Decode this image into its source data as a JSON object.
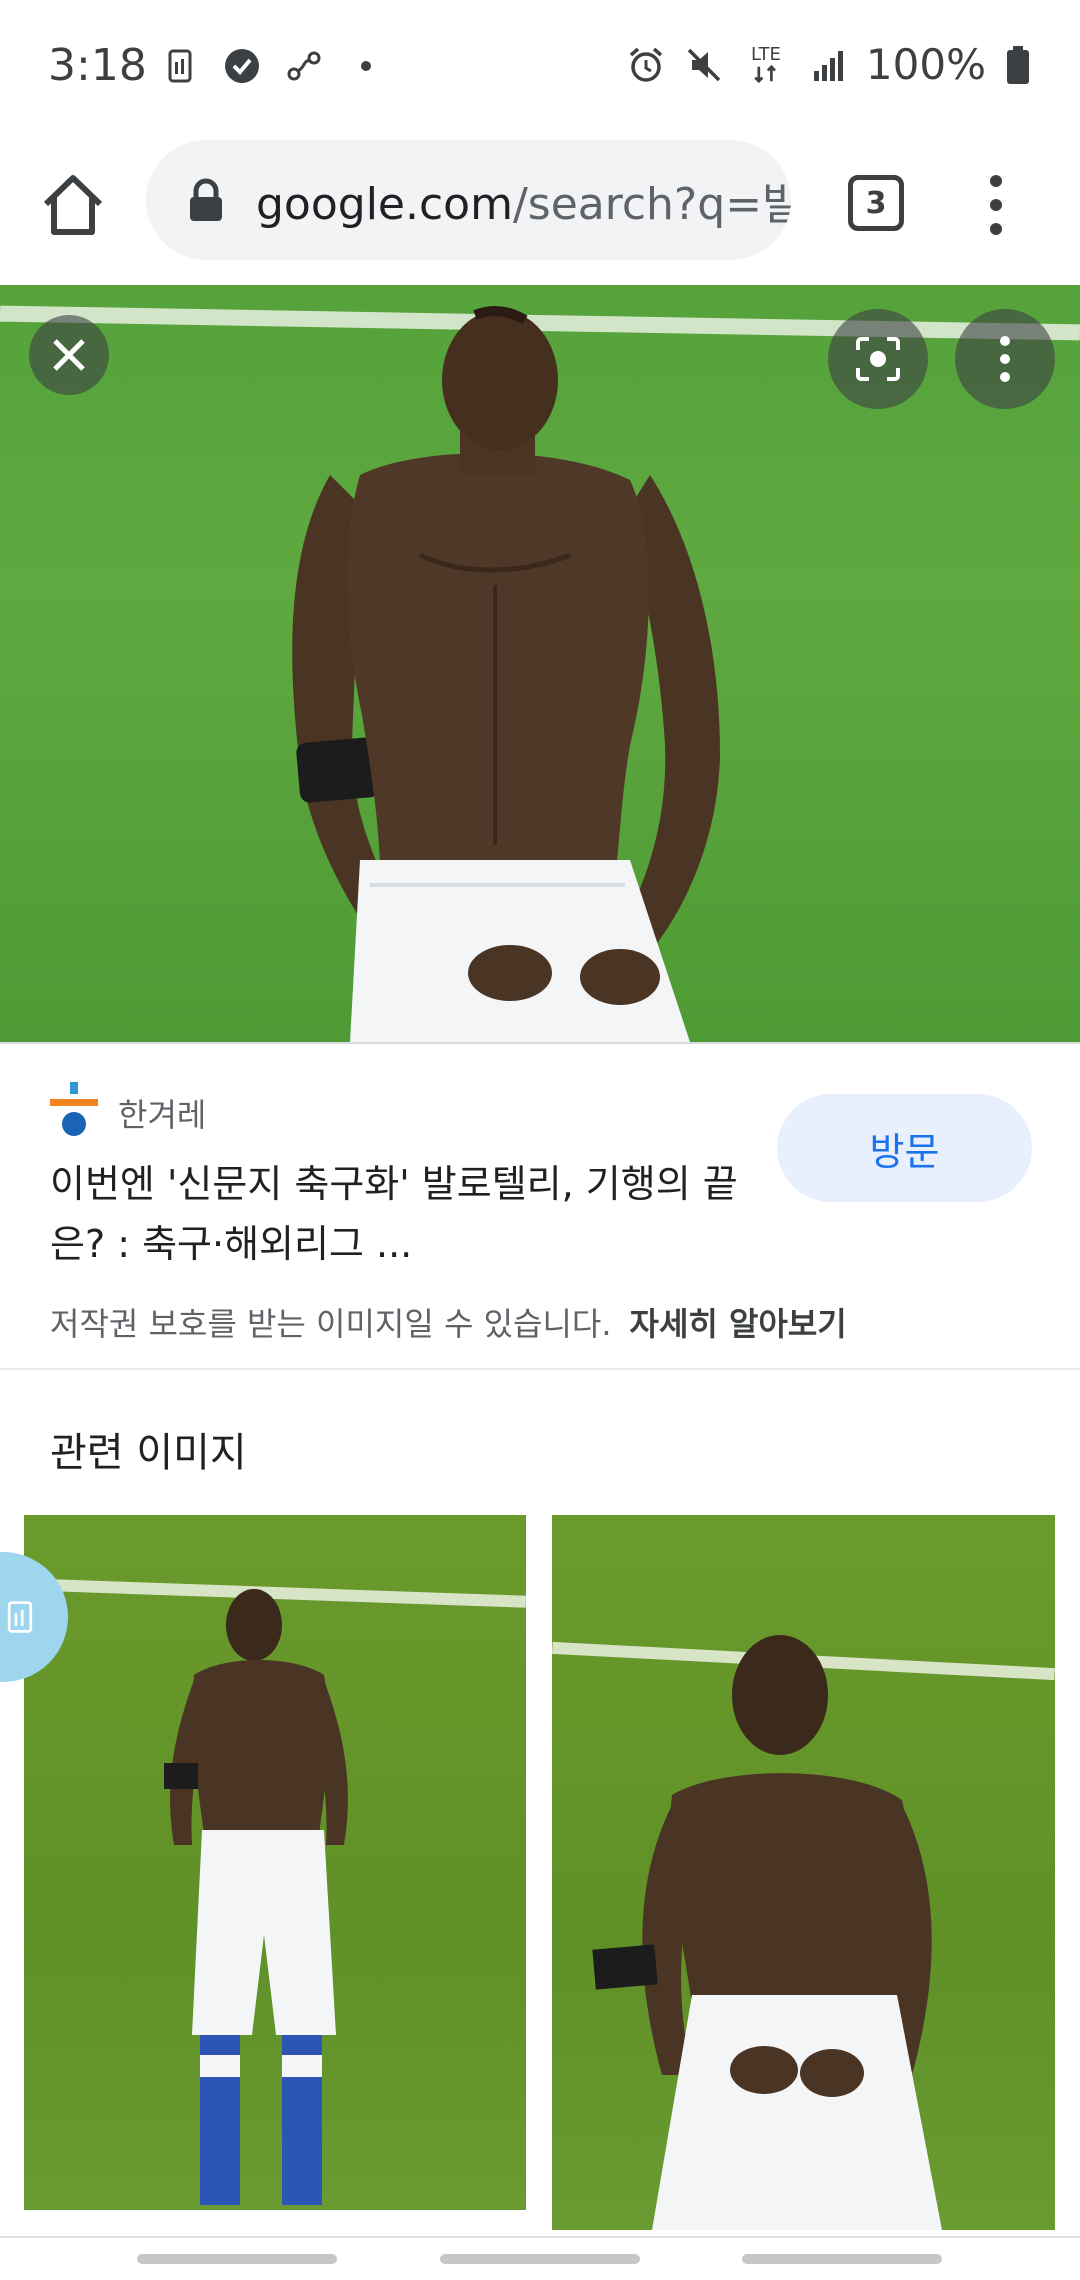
{
  "status_bar": {
    "time": "3:18",
    "battery": "100%",
    "left_icons": [
      "sim-icon",
      "check-shield-icon",
      "link-icon",
      "dot-icon"
    ],
    "right_icons": [
      "alarm-icon",
      "mute-icon",
      "lte-icon",
      "signal-icon",
      "battery-icon"
    ],
    "lte_label": "LTE"
  },
  "toolbar": {
    "url_host": "google.com",
    "url_path": "/search?q=발",
    "tab_count": "3"
  },
  "hero": {
    "close_icon": "close-icon",
    "lens_icon": "lens-icon",
    "more_icon": "more-vert-icon"
  },
  "source": {
    "name": "한겨레",
    "title": "이번엔 '신문지 축구화' 발로텔리, 기행의 끝은? : 축구·해외리그 ...",
    "visit_label": "방문",
    "copyright_text": "저작권 보호를 받는 이미지일 수 있습니다.",
    "learn_more": "자세히 알아보기",
    "logo_colors": [
      "#2d9bd2",
      "#f58220",
      "#1b64b5"
    ]
  },
  "related": {
    "title": "관련 이미지"
  },
  "colors": {
    "accent": "#1a73e8",
    "visit_bg": "#e8f0fe",
    "omnibox_bg": "#f1f3f4"
  }
}
